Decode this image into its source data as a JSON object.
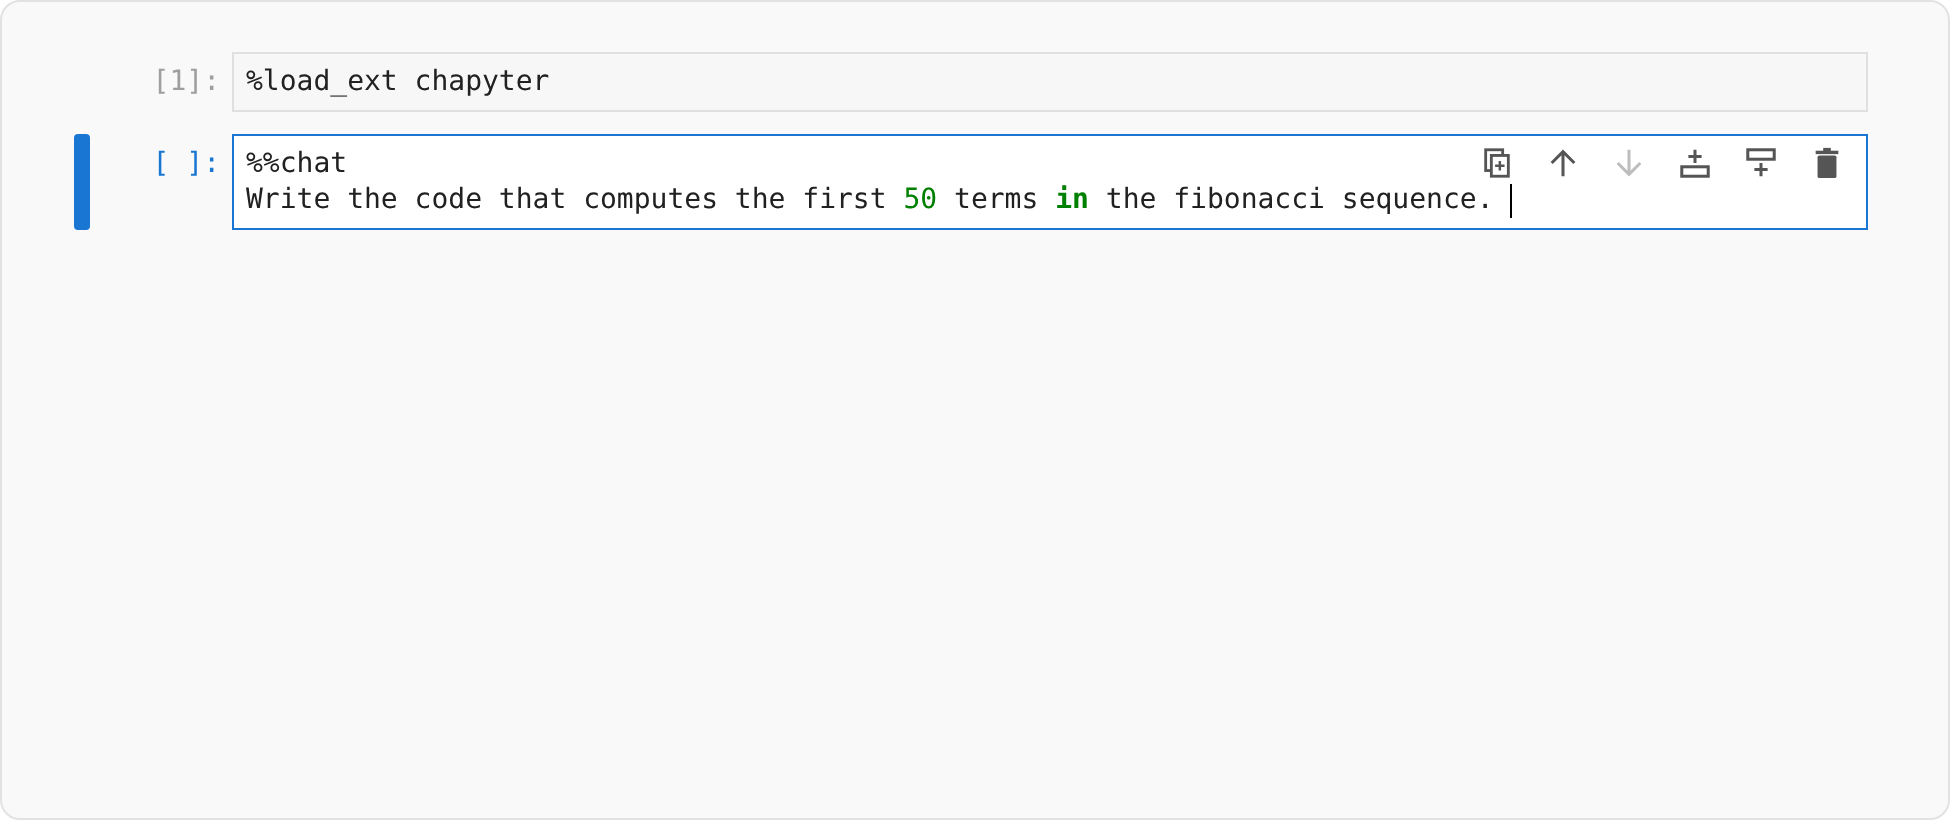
{
  "cells": [
    {
      "prompt": "[1]:",
      "selected": false,
      "lines": [
        [
          {
            "kind": "text",
            "text": "%load_ext chapyter"
          }
        ]
      ]
    },
    {
      "prompt": "[ ]:",
      "selected": true,
      "cursor": true,
      "toolbar": [
        {
          "kind": "duplicate",
          "disabled": false
        },
        {
          "kind": "move-up",
          "disabled": false
        },
        {
          "kind": "move-down",
          "disabled": true
        },
        {
          "kind": "insert-above",
          "disabled": false
        },
        {
          "kind": "insert-below",
          "disabled": false
        },
        {
          "kind": "delete",
          "disabled": false
        }
      ],
      "lines": [
        [
          {
            "kind": "text",
            "text": "%%chat"
          }
        ],
        [
          {
            "kind": "text",
            "text": "Write the code that computes the first "
          },
          {
            "kind": "number",
            "text": "50"
          },
          {
            "kind": "text",
            "text": " terms "
          },
          {
            "kind": "keyword",
            "text": "in"
          },
          {
            "kind": "text",
            "text": " the fibonacci sequence. "
          }
        ]
      ]
    }
  ]
}
